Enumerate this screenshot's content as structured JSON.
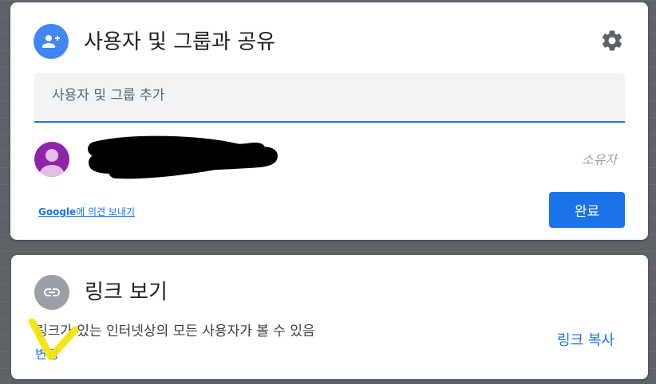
{
  "share": {
    "title": "사용자 및 그룹과 공유",
    "add_placeholder": "사용자 및 그룹 추가",
    "owner_label": "소유자",
    "feedback_brand": "Google",
    "feedback_text": "에 의견 보내기",
    "done_label": "완료",
    "icon": "person-add-icon",
    "settings_icon": "gear-icon"
  },
  "link": {
    "title": "링크 보기",
    "description": "링크가 있는 인터넷상의 모든 사용자가 볼 수 있음",
    "change_label": "변경",
    "copy_label": "링크 복사",
    "icon": "link-icon"
  },
  "colors": {
    "accent": "#1a73e8",
    "share_icon_bg": "#4285f4",
    "link_icon_bg": "#9aa0a6",
    "avatar_bg": "#8e24aa",
    "highlight": "#f5e400"
  }
}
